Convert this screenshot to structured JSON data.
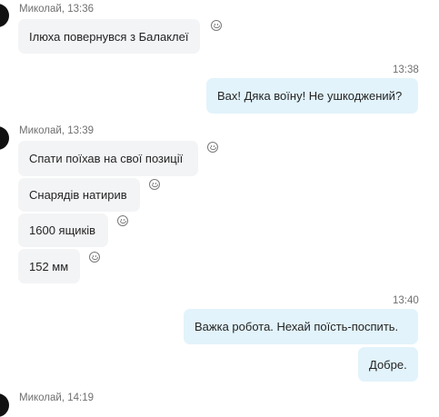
{
  "messages": [
    {
      "sender_meta": "Миколай, 13:36",
      "text": "Ілюха повернувся з Балаклеї"
    },
    {
      "time": "13:38",
      "text": "Вах! Дяка воїну! Не ушкоджений?"
    },
    {
      "sender_meta": "Миколай, 13:39",
      "text": "Спати поїхав на свої позиції"
    },
    {
      "text": "Снарядів натирив"
    },
    {
      "text": "1600 ящиків"
    },
    {
      "text": "152 мм"
    },
    {
      "time": "13:40",
      "text": "Важка робота. Нехай поїсть-поспить."
    },
    {
      "text": "Добре."
    },
    {
      "sender_meta": "Миколай, 14:19"
    }
  ],
  "icons": {
    "reaction": "smiley-face-icon",
    "avatar": "contact-avatar"
  }
}
